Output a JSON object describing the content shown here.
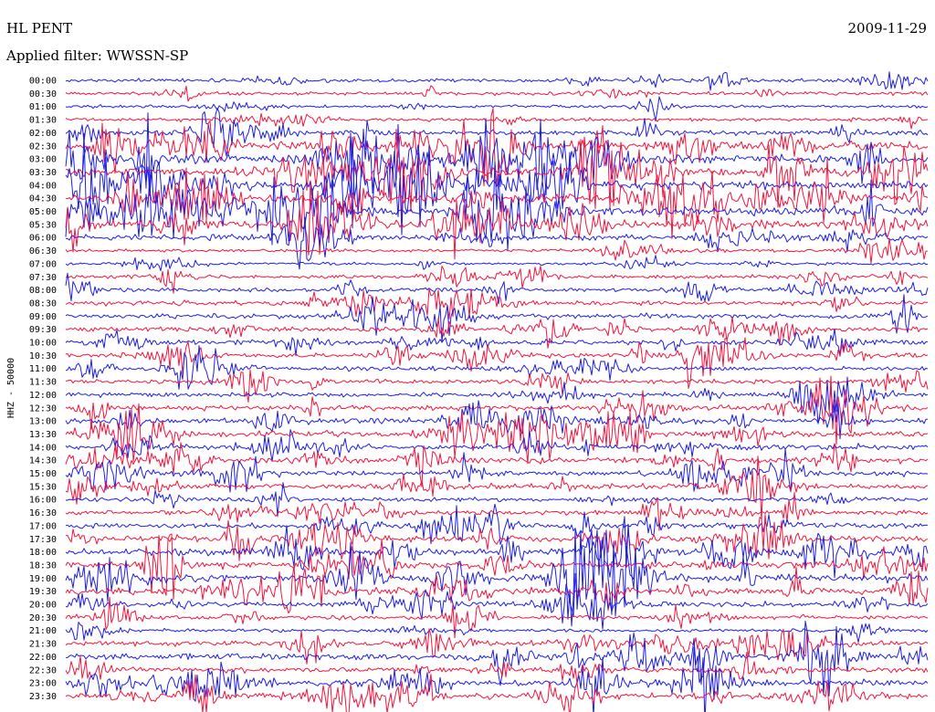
{
  "header": {
    "station": "HL PENT",
    "filter": "Applied filter: WWSSN-SP",
    "date": "2009-11-29"
  },
  "chart_data": {
    "type": "line",
    "title": "HL PENT",
    "subtitle": "Applied filter: WWSSN-SP",
    "date": "2009-11-29",
    "ylabel": "HHZ - 50000",
    "xlabel": "",
    "grid": false,
    "legend": "none",
    "colors": [
      "#1e1ee6",
      "#f5143c"
    ],
    "rows": [
      {
        "label": "00:00",
        "activity": 0.25,
        "color": "#1e1ee6"
      },
      {
        "label": "00:30",
        "activity": 0.2,
        "color": "#f5143c"
      },
      {
        "label": "01:00",
        "activity": 0.15,
        "color": "#1e1ee6"
      },
      {
        "label": "01:30",
        "activity": 0.2,
        "color": "#f5143c"
      },
      {
        "label": "02:00",
        "activity": 0.45,
        "color": "#1e1ee6"
      },
      {
        "label": "02:30",
        "activity": 0.95,
        "color": "#f5143c"
      },
      {
        "label": "03:00",
        "activity": 1.0,
        "color": "#1e1ee6"
      },
      {
        "label": "03:30",
        "activity": 1.0,
        "color": "#f5143c"
      },
      {
        "label": "04:00",
        "activity": 1.0,
        "color": "#1e1ee6"
      },
      {
        "label": "04:30",
        "activity": 1.0,
        "color": "#f5143c"
      },
      {
        "label": "05:00",
        "activity": 1.0,
        "color": "#1e1ee6"
      },
      {
        "label": "05:30",
        "activity": 0.95,
        "color": "#f5143c"
      },
      {
        "label": "06:00",
        "activity": 0.5,
        "color": "#1e1ee6"
      },
      {
        "label": "06:30",
        "activity": 0.2,
        "color": "#f5143c"
      },
      {
        "label": "07:00",
        "activity": 0.15,
        "color": "#1e1ee6"
      },
      {
        "label": "07:30",
        "activity": 0.3,
        "color": "#f5143c"
      },
      {
        "label": "08:00",
        "activity": 0.35,
        "color": "#1e1ee6"
      },
      {
        "label": "08:30",
        "activity": 0.4,
        "color": "#f5143c"
      },
      {
        "label": "09:00",
        "activity": 0.45,
        "color": "#1e1ee6"
      },
      {
        "label": "09:30",
        "activity": 0.45,
        "color": "#f5143c"
      },
      {
        "label": "10:00",
        "activity": 0.4,
        "color": "#1e1ee6"
      },
      {
        "label": "10:30",
        "activity": 0.5,
        "color": "#f5143c"
      },
      {
        "label": "11:00",
        "activity": 0.35,
        "color": "#1e1ee6"
      },
      {
        "label": "11:30",
        "activity": 0.3,
        "color": "#f5143c"
      },
      {
        "label": "12:00",
        "activity": 0.35,
        "color": "#1e1ee6"
      },
      {
        "label": "12:30",
        "activity": 0.5,
        "color": "#f5143c"
      },
      {
        "label": "13:00",
        "activity": 0.55,
        "color": "#1e1ee6"
      },
      {
        "label": "13:30",
        "activity": 0.6,
        "color": "#f5143c"
      },
      {
        "label": "14:00",
        "activity": 0.55,
        "color": "#1e1ee6"
      },
      {
        "label": "14:30",
        "activity": 0.55,
        "color": "#f5143c"
      },
      {
        "label": "15:00",
        "activity": 0.5,
        "color": "#1e1ee6"
      },
      {
        "label": "15:30",
        "activity": 0.5,
        "color": "#f5143c"
      },
      {
        "label": "16:00",
        "activity": 0.3,
        "color": "#1e1ee6"
      },
      {
        "label": "16:30",
        "activity": 0.4,
        "color": "#f5143c"
      },
      {
        "label": "17:00",
        "activity": 0.5,
        "color": "#1e1ee6"
      },
      {
        "label": "17:30",
        "activity": 0.65,
        "color": "#f5143c"
      },
      {
        "label": "18:00",
        "activity": 0.75,
        "color": "#1e1ee6"
      },
      {
        "label": "18:30",
        "activity": 0.8,
        "color": "#f5143c"
      },
      {
        "label": "19:00",
        "activity": 0.85,
        "color": "#1e1ee6"
      },
      {
        "label": "19:30",
        "activity": 0.75,
        "color": "#f5143c"
      },
      {
        "label": "20:00",
        "activity": 0.45,
        "color": "#1e1ee6"
      },
      {
        "label": "20:30",
        "activity": 0.35,
        "color": "#f5143c"
      },
      {
        "label": "21:00",
        "activity": 0.2,
        "color": "#1e1ee6"
      },
      {
        "label": "21:30",
        "activity": 0.5,
        "color": "#f5143c"
      },
      {
        "label": "22:00",
        "activity": 0.7,
        "color": "#1e1ee6"
      },
      {
        "label": "22:30",
        "activity": 0.5,
        "color": "#f5143c"
      },
      {
        "label": "23:00",
        "activity": 0.6,
        "color": "#1e1ee6"
      },
      {
        "label": "23:30",
        "activity": 0.6,
        "color": "#f5143c"
      }
    ]
  }
}
